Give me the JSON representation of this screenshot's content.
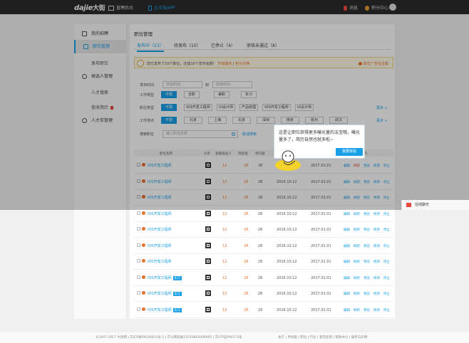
{
  "topbar": {
    "logo": "dajie",
    "logo_cn": "大街",
    "nav_admin": "直聘后台",
    "nav_app": "企业版APP",
    "messages": "消息",
    "points": "积分中心"
  },
  "sidebar": {
    "items": [
      {
        "label": "我的招聘"
      },
      {
        "label": "职位管理"
      },
      {
        "label": "发布职位"
      },
      {
        "label": "候选人管理"
      },
      {
        "label": "人才搜索"
      },
      {
        "label": "查收简历"
      },
      {
        "label": "人才库管理"
      }
    ]
  },
  "main": {
    "breadcrumb": "职位管理",
    "tabs": [
      {
        "label": "发布中（23）"
      },
      {
        "label": "待发布（10）"
      },
      {
        "label": "已停止（4）"
      },
      {
        "label": "审核未通过（8）"
      }
    ],
    "notice": {
      "text": "您已发布了10个职位，还能10个发布名额！",
      "link1": "升级服务",
      "link2": "积分兑换",
      "right": "职位广告位设置"
    },
    "filters": {
      "publish_time": "发布时间",
      "start_placeholder": "开始时间",
      "to": "到",
      "end_placeholder": "结束时间",
      "job_type_label": "工作类型",
      "job_types": [
        "不限",
        "全职",
        "兼职",
        "实习"
      ],
      "category_label": "职位类型",
      "categories": [
        "不限",
        "IOS开发工程师",
        "UI设计师",
        "产品经理",
        "IOS开发工程师",
        "UI设计师"
      ],
      "location_label": "工作地点",
      "locations": [
        "不限",
        "北京",
        "上海",
        "北京",
        "深圳",
        "南京",
        "杭州",
        "武汉"
      ],
      "more": "更多",
      "search_label": "搜索职位",
      "search_placeholder": "输入职位名称",
      "search_button": "取消搜索"
    },
    "table": {
      "headers": [
        "职位名称",
        "分享",
        "查看候选人",
        "待处理",
        "待沟通",
        "发布时间",
        "截止时间",
        "操作"
      ],
      "rows": [
        {
          "name": "IOS开发工程师",
          "tag": "",
          "a": "12",
          "b": "28",
          "c": "28",
          "d1": "2016.10.12",
          "d2": "2017.01.01"
        },
        {
          "name": "IOS开发工程师",
          "tag": "",
          "a": "12",
          "b": "28",
          "c": "28",
          "d1": "2016.10.12",
          "d2": "2017.01.01"
        },
        {
          "name": "IOS开发工程师",
          "tag": "",
          "a": "12",
          "b": "28",
          "c": "28",
          "d1": "2016.10.12",
          "d2": "2017.01.01"
        },
        {
          "name": "IOS开发工程师",
          "tag": "",
          "a": "12",
          "b": "28",
          "c": "28",
          "d1": "2016.10.12",
          "d2": "2017.01.01"
        },
        {
          "name": "IOS开发工程师",
          "tag": "",
          "a": "12",
          "b": "28",
          "c": "28",
          "d1": "2016.10.12",
          "d2": "2017.01.01"
        },
        {
          "name": "IOS开发工程师",
          "tag": "",
          "a": "12",
          "b": "28",
          "c": "28",
          "d1": "2016.10.12",
          "d2": "2017.01.01"
        },
        {
          "name": "IOS开发工程师",
          "tag": "",
          "a": "12",
          "b": "28",
          "c": "28",
          "d1": "2016.10.12",
          "d2": "2017.01.01"
        },
        {
          "name": "IOS开发工程师",
          "tag": "实习",
          "a": "12",
          "b": "28",
          "c": "28",
          "d1": "2016.10.12",
          "d2": "2017.01.01"
        },
        {
          "name": "IOS开发工程师",
          "tag": "实习",
          "a": "12",
          "b": "28",
          "c": "28",
          "d1": "2016.10.12",
          "d2": "2017.01.01"
        },
        {
          "name": "IOS开发工程师",
          "tag": "实习",
          "a": "12",
          "b": "28",
          "c": "29",
          "d1": "2016.10.12",
          "d2": "2017.01.01"
        }
      ],
      "actions": [
        "编辑",
        "刷新",
        "预览",
        "修改",
        "停止"
      ]
    }
  },
  "tooltip": {
    "text": "这是让职位获得更多曝光量的法宝哦，曝光量多了，简历自然也就多啦~",
    "button": "我要体验"
  },
  "chat": {
    "label": "在线聊天"
  },
  "footer": {
    "left": "©2007-2017 大街网 | 京ICP备09026813号-1 | 京公网安备11010802008965 | 京ICP证090173号",
    "right": "关于 | 手机版 | 职位 | 行业 | 意见反馈 | 帮助中心 | 服务与声明"
  },
  "colors": {
    "accent": "#1aa0e6",
    "warning": "#e8702a",
    "danger": "#e84a3c"
  }
}
